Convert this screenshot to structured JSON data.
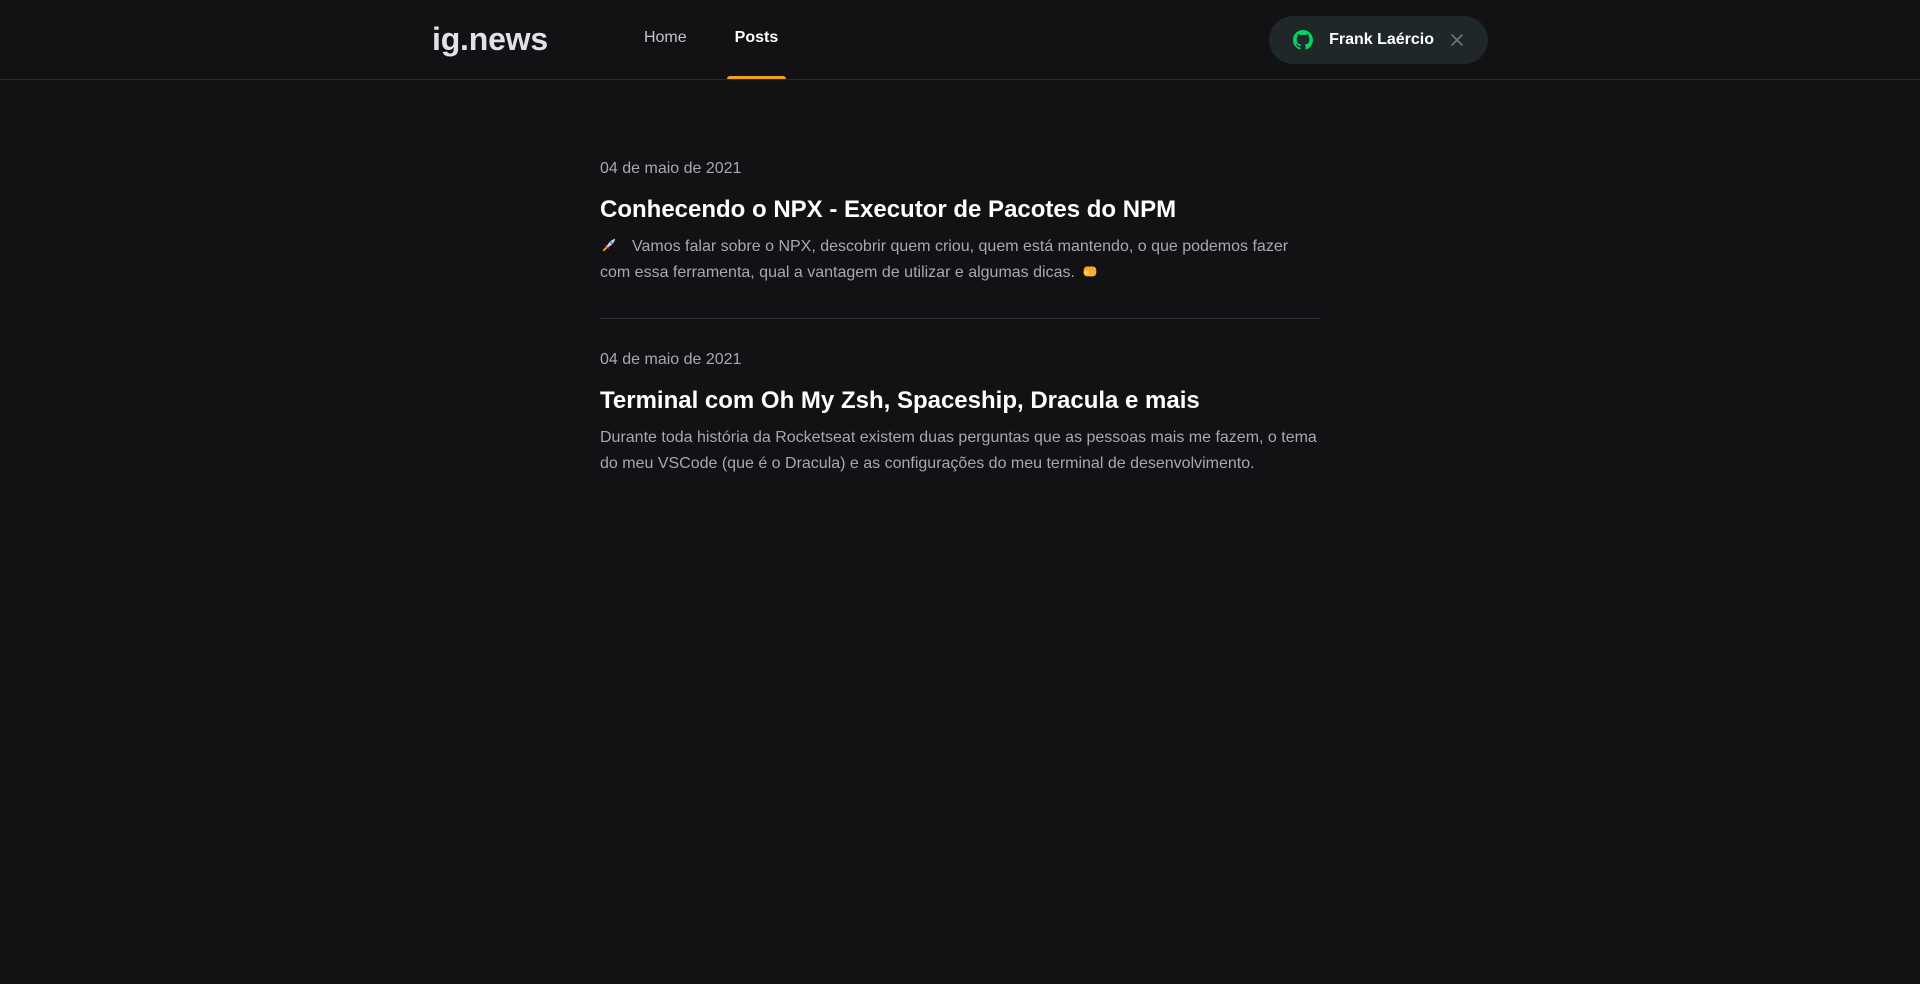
{
  "header": {
    "logo": "ig.news",
    "nav": [
      {
        "label": "Home",
        "active": false
      },
      {
        "label": "Posts",
        "active": true
      }
    ],
    "user_button": {
      "icon": "github-icon",
      "username": "Frank Laércio",
      "close_icon": "close-icon"
    }
  },
  "colors": {
    "background": "#121214",
    "accent": "#eba417",
    "github_green": "#04d361",
    "text_primary": "#ffffff",
    "text_muted": "#a8a8b3"
  },
  "posts": [
    {
      "date": "04 de maio de 2021",
      "title": "Conhecendo o NPX - Executor de Pacotes do NPM",
      "excerpt_icon": "rocket-icon",
      "excerpt": "Vamos falar sobre o NPX, descobrir quem criou, quem está mantendo, o que podemos fazer com essa ferramenta, qual a vantagem de utilizar e algumas dicas.",
      "excerpt_end_icon": "fist-icon"
    },
    {
      "date": "04 de maio de 2021",
      "title": "Terminal com Oh My Zsh, Spaceship, Dracula e mais",
      "excerpt": "Durante toda história da Rocketseat existem duas perguntas que as pessoas mais me fazem, o tema do meu VSCode (que é o Dracula) e as configurações do meu terminal de desenvolvimento."
    }
  ]
}
